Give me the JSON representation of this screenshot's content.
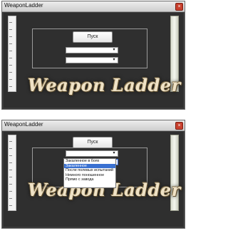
{
  "window1": {
    "title": "WeaponLadder",
    "close": "×",
    "start_button": "Пуск",
    "combo1": "",
    "combo2": "",
    "arrow": "▾",
    "banner": "Weapon Ladder"
  },
  "window2": {
    "title": "WeaponLadder",
    "close": "×",
    "start_button": "Пуск",
    "combo1": "",
    "combo2": "",
    "arrow": "▾",
    "banner": "Weapon Ladder",
    "dropdown": {
      "items": [
        "Закаленное в боях",
        "Закаленное",
        "После полевых испытаний",
        "Немного поношенное",
        "Прямо с завода"
      ],
      "selected_index": 1
    }
  }
}
